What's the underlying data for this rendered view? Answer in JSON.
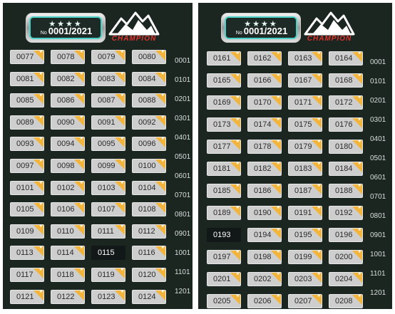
{
  "left_panel": {
    "banner": {
      "stars": "★★★★",
      "no_label": "No",
      "serial": "0001/2021",
      "brand": "CHAMPION"
    },
    "selected": "0115",
    "tiles": [
      "0077",
      "0078",
      "0079",
      "0080",
      "0081",
      "0082",
      "0083",
      "0084",
      "0085",
      "0086",
      "0087",
      "0088",
      "0089",
      "0090",
      "0091",
      "0092",
      "0093",
      "0094",
      "0095",
      "0096",
      "0097",
      "0098",
      "0099",
      "0100",
      "0101",
      "0102",
      "0103",
      "0104",
      "0105",
      "0106",
      "0107",
      "0108",
      "0109",
      "0110",
      "0111",
      "0112",
      "0113",
      "0114",
      "0115",
      "0116",
      "0117",
      "0118",
      "0119",
      "0120",
      "0121",
      "0122",
      "0123",
      "0124"
    ],
    "ranges": [
      "0001",
      "0101",
      "0201",
      "0301",
      "0401",
      "0501",
      "0601",
      "0701",
      "0801",
      "0901",
      "1001",
      "1101",
      "1201"
    ]
  },
  "right_panel": {
    "banner": {
      "stars": "★★★★",
      "no_label": "No",
      "serial": "0001/2021",
      "brand": "CHAMPION"
    },
    "selected": "0193",
    "tiles": [
      "0161",
      "0162",
      "0163",
      "0164",
      "0165",
      "0166",
      "0167",
      "0168",
      "0169",
      "0170",
      "0171",
      "0172",
      "0173",
      "0174",
      "0175",
      "0176",
      "0177",
      "0178",
      "0179",
      "0180",
      "0181",
      "0182",
      "0183",
      "0184",
      "0185",
      "0186",
      "0187",
      "0188",
      "0189",
      "0190",
      "0191",
      "0192",
      "0193",
      "0194",
      "0195",
      "0196",
      "0197",
      "0198",
      "0199",
      "0200",
      "0201",
      "0202",
      "0203",
      "0204",
      "0205",
      "0206",
      "0207",
      "0208"
    ],
    "ranges": [
      "0001",
      "0101",
      "0201",
      "0301",
      "0401",
      "0501",
      "0601",
      "0701",
      "0801",
      "0901",
      "1001",
      "1101",
      "1201"
    ]
  },
  "colors": {
    "background": "#1b2621",
    "tile": "#cecece",
    "tile_selected": "#121817",
    "corner_flag": "#f2b43a",
    "banner_accent": "#4ad2c6",
    "brand_red": "#e0322d"
  }
}
